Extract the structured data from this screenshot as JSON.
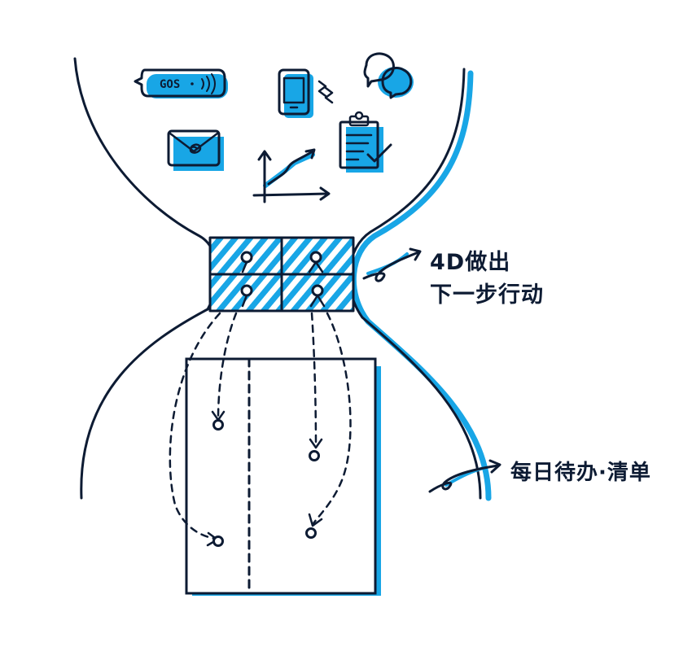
{
  "sms_text": "GOS",
  "labels": {
    "top_next_action_line1": "4D做出",
    "top_next_action_line2": "下一步行动",
    "bottom_daily_todo": "每日待办·清单"
  },
  "colors": {
    "ink": "#0d1b33",
    "accent": "#18a6e6",
    "background": "#ffffff"
  },
  "icons": [
    "sms-bubble-icon",
    "phone-vibrate-icon",
    "chat-bubbles-icon",
    "mail-envelope-icon",
    "growth-chart-icon",
    "clipboard-check-icon"
  ]
}
